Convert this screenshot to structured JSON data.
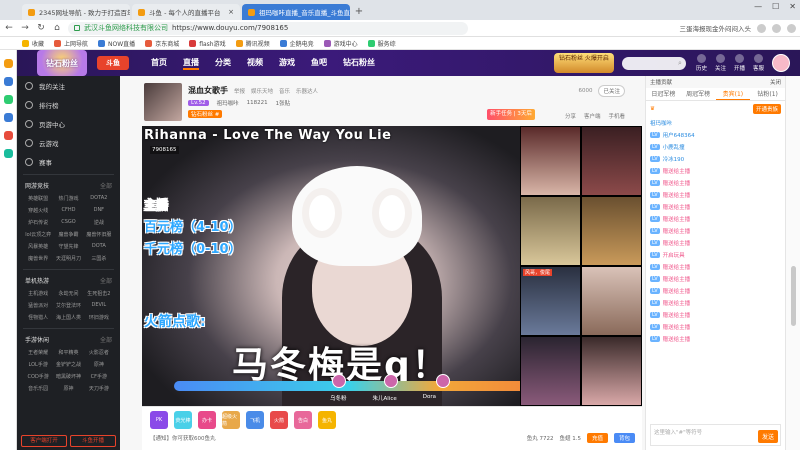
{
  "browser": {
    "tabs": [
      {
        "label": "2345网址导航 - 致力于打造百年品牌"
      },
      {
        "label": "斗鱼 - 每个人的直播平台"
      },
      {
        "label": "祖玛咖咔直播_音乐直播_斗鱼直播"
      }
    ],
    "url": "https://www.douyu.com/7908165",
    "url_prefix": "武汉斗鱼网络科技有限公司",
    "right_text": "三蛋海报现金外闷闷入头"
  },
  "bookmarks": [
    "收藏",
    "上网导航",
    "NOW直播",
    "京东商城",
    "flash游戏",
    "腾讯视频",
    "企鹅电竞",
    "游戏中心",
    "服务综"
  ],
  "header": {
    "logo": "钻石粉丝",
    "brand": "斗鱼",
    "nav": [
      "首页",
      "直播",
      "分类",
      "视频",
      "游戏",
      "鱼吧",
      "钻石粉丝"
    ],
    "promo": "钻石粉丝 火爆开启",
    "icons": [
      "历史",
      "关注",
      "开播",
      "客服"
    ]
  },
  "sidebar": {
    "items": [
      "我的关注",
      "排行榜",
      "页游中心",
      "云游戏",
      "赛事"
    ],
    "sections": [
      {
        "title": "网游竞技",
        "more": "全部",
        "games": [
          "英雄联盟",
          "热门游戏",
          "DOTA2",
          "穿越火线",
          "CFHD",
          "DNF",
          "炉石传说",
          "CSGO",
          "逆战",
          "lol云顶之弈",
          "魔兽争霸",
          "魔兽怀旧服",
          "风暴英雄",
          "守望先锋",
          "DOTA",
          "魔兽世界",
          "天涯明月刀",
          "三国杀"
        ]
      },
      {
        "title": "单机热游",
        "more": "全部",
        "games": [
          "主机游戏",
          "永劫无间",
          "生死狙击2",
          "猛兽派对",
          "艾尔登法环",
          "DEVIL",
          "怪物猎人",
          "海上国人类",
          "环旧游戏"
        ]
      },
      {
        "title": "手游休闲",
        "more": "全部",
        "games": [
          "王者荣耀",
          "和平精英",
          "火影忍者",
          "LOL手游",
          "金铲铲之战",
          "原神",
          "COD手游",
          "暗黑破坏神",
          "CF手游",
          "音乐乐园",
          "原神",
          "天刀手游"
        ]
      }
    ],
    "bottom": [
      "客户端打开",
      "斗鱼开播"
    ]
  },
  "room": {
    "title": "混血女歌手",
    "tags": [
      "举报",
      "娱乐天地",
      "音乐",
      "乐器达人"
    ],
    "level": "Lv.52",
    "host": "祖玛咖咔",
    "followers": "118221",
    "gift_rank": "1张贴",
    "badge": "钻石粉丝 #",
    "meta": [
      "6000",
      "已关注"
    ],
    "report_btn": "新手任务 | 3天后",
    "share": [
      "分享",
      "客户端",
      "手机看"
    ]
  },
  "video": {
    "song_title": "Rihanna - Love The Way You Lie",
    "room_id": "7908165",
    "overlay_lines": [
      "主播",
      "百元榜（4-10）",
      "千元榜（0-10）",
      "火箭点歌:"
    ],
    "big_text": "马冬梅是q！",
    "pk_labels": [
      "乌冬粉",
      "朱儿Alice",
      "Dora"
    ],
    "cam_tip": "风哥，俊尾"
  },
  "controls": {
    "gifts": [
      "PK",
      "荧光棒",
      "办卡",
      "超级火箭",
      "飞机",
      "火箭",
      "告白",
      "鱼丸"
    ],
    "fishball": "鱼丸 7722",
    "fishball2": "鱼翅 1.5",
    "recharge": "充值",
    "bag": "背包",
    "notice": "【通知】你可获取600鱼丸"
  },
  "chat": {
    "top_left": "主播贡献",
    "top_right": "关闭",
    "tabs": [
      "日冠军榜",
      "周冠军榜",
      "贵宾(1)",
      "钻粉(1)"
    ],
    "noble_text": "开通贵族",
    "messages": [
      {
        "lv": "",
        "fan": "",
        "name": "祖玛咖咔",
        "text": ""
      },
      {
        "lv": "LV",
        "fan": "",
        "name": "用户648364",
        "text": ""
      },
      {
        "lv": "LV",
        "fan": "",
        "name": "小鹿乱撞",
        "text": ""
      },
      {
        "lv": "LV",
        "fan": "",
        "name": "冷冰190",
        "text": ""
      },
      {
        "lv": "LV",
        "fan": "",
        "name": "",
        "text": "赠送给主播"
      },
      {
        "lv": "LV",
        "fan": "",
        "name": "",
        "text": "赠送给主播"
      },
      {
        "lv": "LV",
        "fan": "",
        "name": "",
        "text": "赠送给主播"
      },
      {
        "lv": "LV",
        "fan": "",
        "name": "",
        "text": "赠送给主播"
      },
      {
        "lv": "LV",
        "fan": "",
        "name": "",
        "text": "赠送给主播"
      },
      {
        "lv": "LV",
        "fan": "",
        "name": "",
        "text": "赠送给主播"
      },
      {
        "lv": "LV",
        "fan": "",
        "name": "",
        "text": "赠送给主播"
      },
      {
        "lv": "LV",
        "fan": "",
        "name": "",
        "text": "开启玩具"
      },
      {
        "lv": "LV",
        "fan": "",
        "name": "",
        "text": "赠送给主播"
      },
      {
        "lv": "LV",
        "fan": "",
        "name": "",
        "text": "赠送给主播"
      },
      {
        "lv": "LV",
        "fan": "",
        "name": "",
        "text": "赠送给主播"
      },
      {
        "lv": "LV",
        "fan": "",
        "name": "",
        "text": "赠送给主播"
      },
      {
        "lv": "LV",
        "fan": "",
        "name": "",
        "text": "赠送给主播"
      },
      {
        "lv": "LV",
        "fan": "",
        "name": "",
        "text": "赠送给主播"
      },
      {
        "lv": "LV",
        "fan": "",
        "name": "",
        "text": "赠送给主播"
      }
    ],
    "input_placeholder": "这里输入\"#\"等符号",
    "send": "发送"
  }
}
